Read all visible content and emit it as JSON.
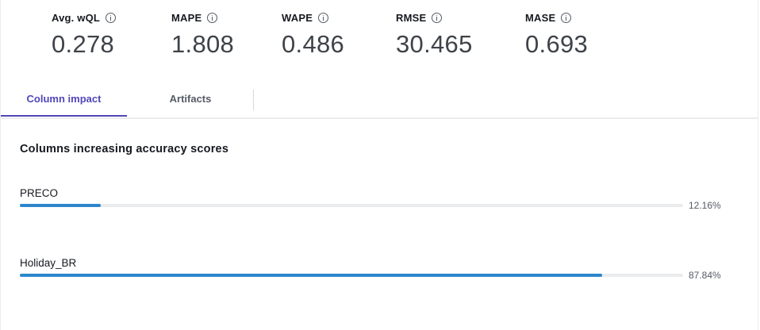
{
  "metrics": [
    {
      "name": "Avg. wQL",
      "value": "0.278"
    },
    {
      "name": "MAPE",
      "value": "1.808"
    },
    {
      "name": "WAPE",
      "value": "0.486"
    },
    {
      "name": "RMSE",
      "value": "30.465"
    },
    {
      "name": "MASE",
      "value": "0.693"
    }
  ],
  "tabs": [
    {
      "label": "Column impact",
      "active": true
    },
    {
      "label": "Artifacts",
      "active": false
    }
  ],
  "section": {
    "title": "Columns increasing accuracy scores",
    "columns": [
      {
        "name": "PRECO",
        "percent_text": "12.16%",
        "fraction": 0.1216
      },
      {
        "name": "Holiday_BR",
        "percent_text": "87.84%",
        "fraction": 0.8784
      }
    ]
  },
  "colors": {
    "accent": "#5046b8",
    "bar": "#2d86cc",
    "track": "#e9ebed"
  }
}
